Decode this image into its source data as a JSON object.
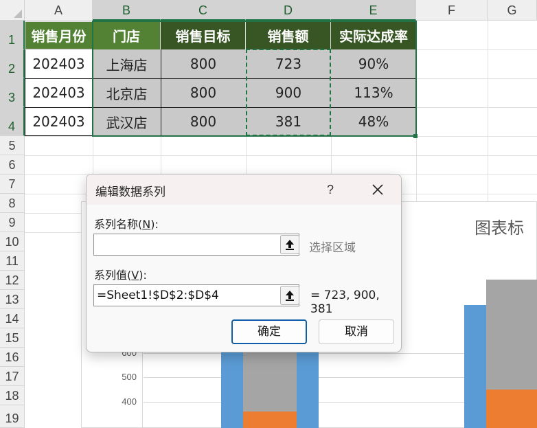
{
  "columns": [
    "A",
    "B",
    "C",
    "D",
    "E",
    "F",
    "G"
  ],
  "rows": [
    "1",
    "2",
    "3",
    "4",
    "5",
    "6",
    "7",
    "8",
    "9",
    "10",
    "11",
    "12",
    "13",
    "14",
    "15",
    "16",
    "17",
    "18",
    "19"
  ],
  "table": {
    "headers": [
      "销售月份",
      "门店",
      "销售目标",
      "销售额",
      "实际达成率"
    ],
    "rows": [
      [
        "202403",
        "上海店",
        "800",
        "723",
        "90%"
      ],
      [
        "202403",
        "北京店",
        "800",
        "900",
        "113%"
      ],
      [
        "202403",
        "武汉店",
        "800",
        "381",
        "48%"
      ]
    ]
  },
  "colors": {
    "header_dark_green": "#375623",
    "header_green": "#548235",
    "selection_gray": "#c9c9c9",
    "selection_border": "#217346",
    "bar_blue": "#5b9bd5",
    "bar_gray": "#a5a5a5",
    "bar_orange": "#ed7d31"
  },
  "chart": {
    "title_partial": "图表标",
    "y_ticks": [
      "600",
      "500",
      "400"
    ]
  },
  "chart_data": {
    "type": "bar",
    "title": "图表标",
    "yticks": [
      600,
      500,
      400
    ],
    "series": [
      {
        "name": "",
        "values": []
      }
    ]
  },
  "dialog": {
    "title": "编辑数据系列",
    "help_icon": "?",
    "series_name_label_pre": "系列名称(",
    "series_name_label_key": "N",
    "series_name_label_post": "):",
    "series_name_value": "",
    "series_name_hint": "选择区域",
    "series_value_label_pre": "系列值(",
    "series_value_label_key": "V",
    "series_value_label_post": "):",
    "series_value_value": "=Sheet1!$D$2:$D$4",
    "series_value_preview": "= 723, 900, 381",
    "ok_label": "确定",
    "cancel_label": "取消"
  }
}
